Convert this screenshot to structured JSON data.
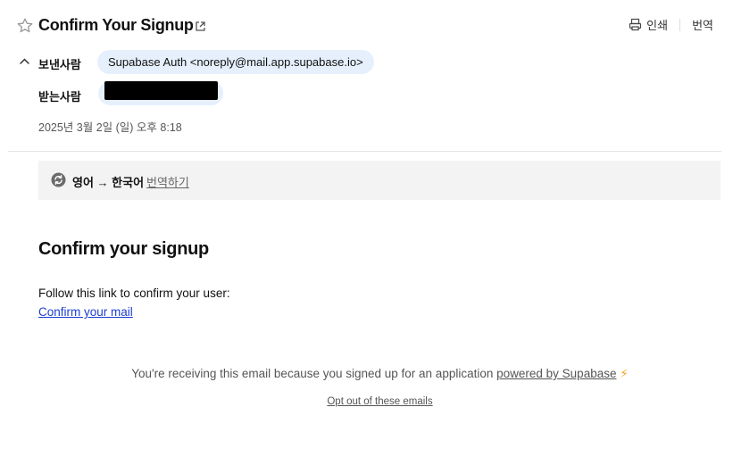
{
  "header": {
    "subject": "Confirm Your Signup",
    "print_label": "인쇄",
    "translate_label": "번역"
  },
  "meta": {
    "from_label": "보낸사람",
    "from_value": "Supabase Auth <noreply@mail.app.supabase.io>",
    "to_label": "받는사람",
    "date": "2025년 3월 2일 (일) 오후 8:18"
  },
  "translation": {
    "langs": "영어 → 한국어",
    "action": "번역하기"
  },
  "body": {
    "title": "Confirm your signup",
    "text": "Follow this link to confirm your user:",
    "link": "Confirm your mail"
  },
  "footer": {
    "text": "You're receiving this email because you signed up for an application",
    "link": "powered by Supabase",
    "emoji": "⚡",
    "optout": "Opt out of these emails"
  },
  "icons": {
    "star": "star-icon",
    "popout": "external-link-icon",
    "print": "print-icon",
    "collapse": "chevron-up-icon",
    "translate": "refresh-icon"
  },
  "colors": {
    "chip_bg": "#e6f0fd",
    "translate_bar_bg": "#f3f3f3",
    "link": "#1d3ecf",
    "bolt": "#f5a623"
  }
}
